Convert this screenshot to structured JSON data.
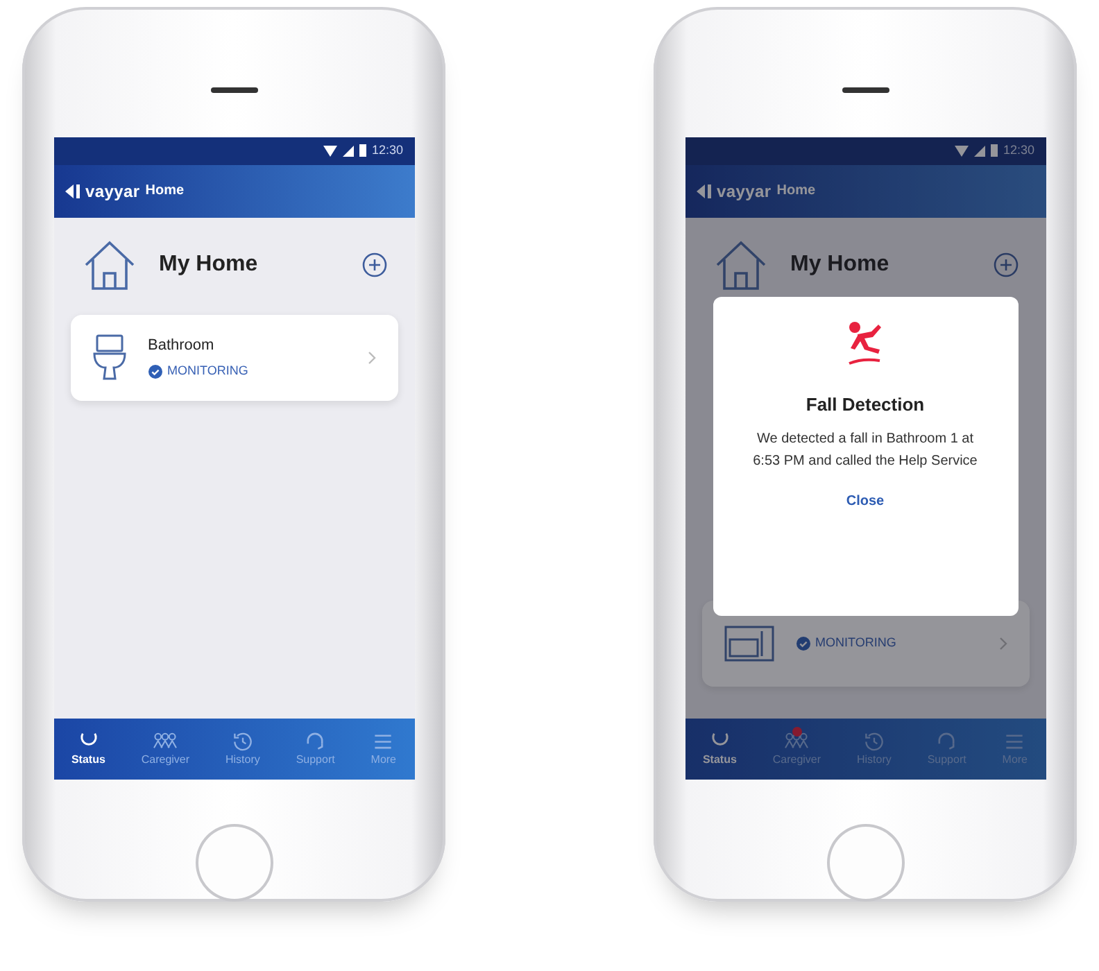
{
  "phones": [
    {
      "status_bar": {
        "time": "12:30"
      },
      "app_bar": {
        "brand": "vayyar",
        "title": "Home"
      },
      "home": {
        "title": "My Home"
      },
      "rooms": [
        {
          "kind": "bathroom",
          "name": "Bathroom",
          "status": "MONITORING"
        }
      ],
      "tabs": [
        {
          "kind": "status",
          "label": "Status",
          "selected": true,
          "badge": false
        },
        {
          "kind": "caregiver",
          "label": "Caregiver",
          "selected": false,
          "badge": false
        },
        {
          "kind": "history",
          "label": "History",
          "selected": false,
          "badge": false
        },
        {
          "kind": "support",
          "label": "Support",
          "selected": false,
          "badge": false
        },
        {
          "kind": "more",
          "label": "More",
          "selected": false,
          "badge": false
        }
      ]
    },
    {
      "status_bar": {
        "time": "12:30"
      },
      "app_bar": {
        "brand": "vayyar",
        "title": "Home"
      },
      "home": {
        "title": "My Home"
      },
      "rooms": [
        {
          "kind": "room",
          "status": "MONITORING"
        }
      ],
      "tabs": [
        {
          "kind": "status",
          "label": "Status",
          "selected": true,
          "badge": false
        },
        {
          "kind": "caregiver",
          "label": "Caregiver",
          "selected": false,
          "badge": true
        },
        {
          "kind": "history",
          "label": "History",
          "selected": false,
          "badge": false
        },
        {
          "kind": "support",
          "label": "Support",
          "selected": false,
          "badge": false
        },
        {
          "kind": "more",
          "label": "More",
          "selected": false,
          "badge": false
        }
      ],
      "dialog": {
        "title": "Fall Detection",
        "message": "We detected a fall in Bathroom 1 at 6:53 PM and called the Help Service",
        "button": "Close"
      }
    }
  ]
}
